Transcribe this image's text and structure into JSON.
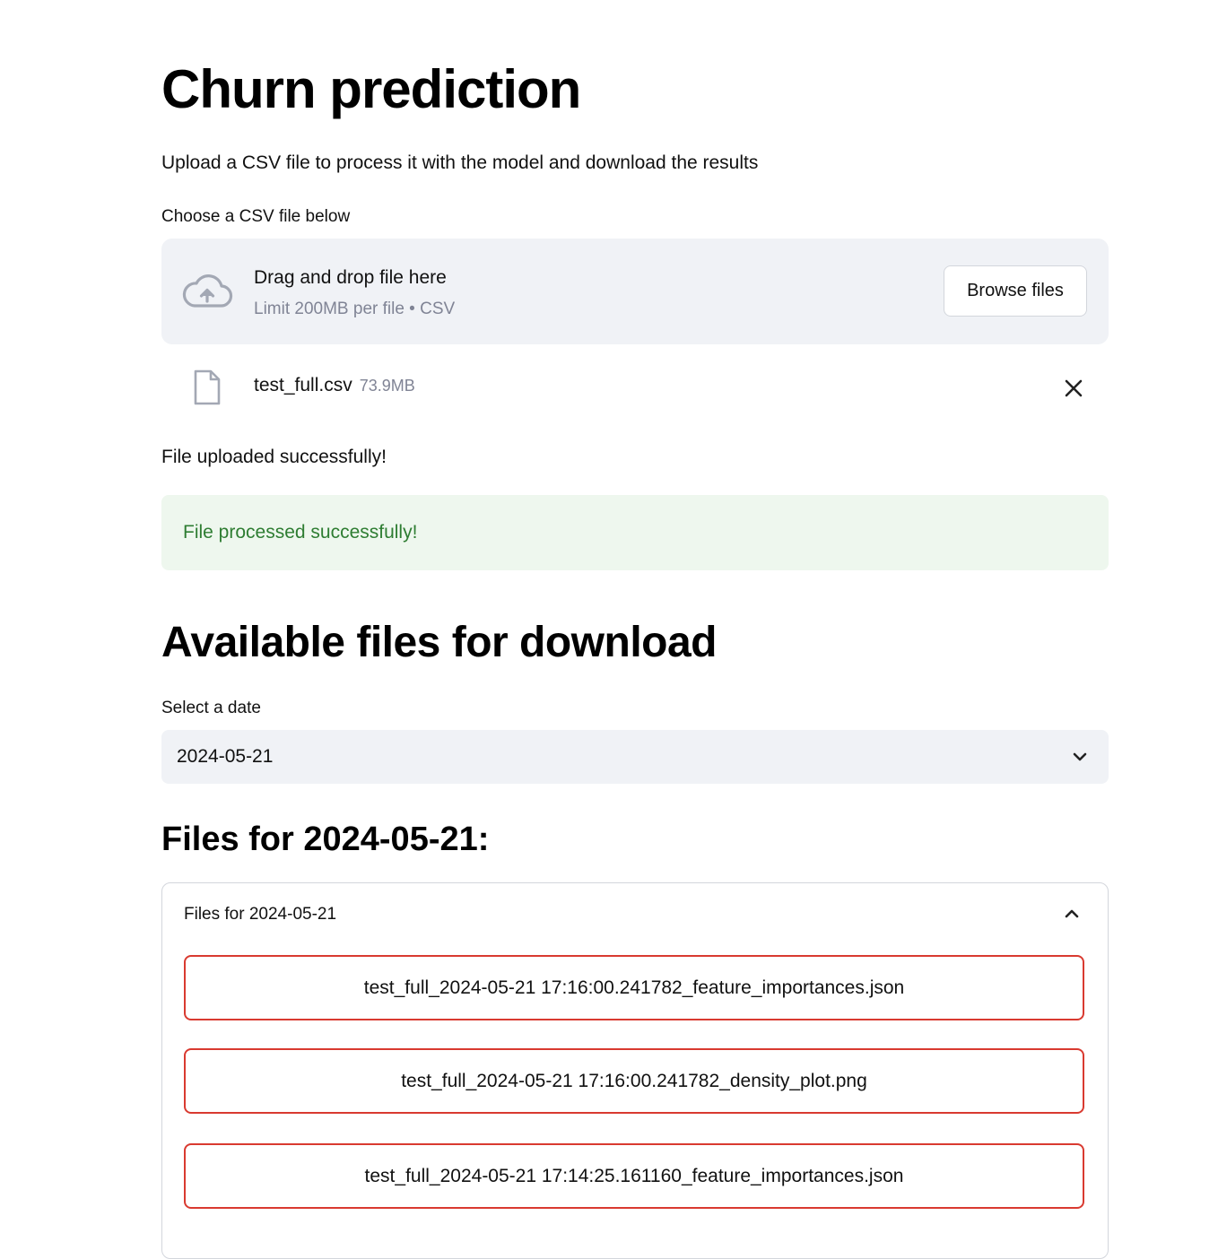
{
  "page": {
    "title": "Churn prediction",
    "subtitle": "Upload a CSV file to process it with the model and download the results"
  },
  "uploader": {
    "label": "Choose a CSV file below",
    "drop_title": "Drag and drop file here",
    "drop_limit": "Limit 200MB per file • CSV",
    "browse_label": "Browse files",
    "icon": "cloud-upload-icon"
  },
  "uploaded_file": {
    "name": "test_full.csv",
    "size": "73.9MB",
    "icon": "file-icon",
    "remove_icon": "close-icon"
  },
  "status": {
    "upload_message": "File uploaded successfully!",
    "process_message": "File processed successfully!",
    "success_color": "#2e7d32",
    "success_bg": "#eef7ee"
  },
  "downloads": {
    "heading": "Available files for download",
    "select_label": "Select a date",
    "selected_date": "2024-05-21",
    "files_heading": "Files for 2024-05-21:",
    "expander_title": "Files for 2024-05-21",
    "files": [
      "test_full_2024-05-21 17:16:00.241782_feature_importances.json",
      "test_full_2024-05-21 17:16:00.241782_density_plot.png",
      "test_full_2024-05-21 17:14:25.161160_feature_importances.json"
    ],
    "button_border_color": "#d93a30"
  }
}
